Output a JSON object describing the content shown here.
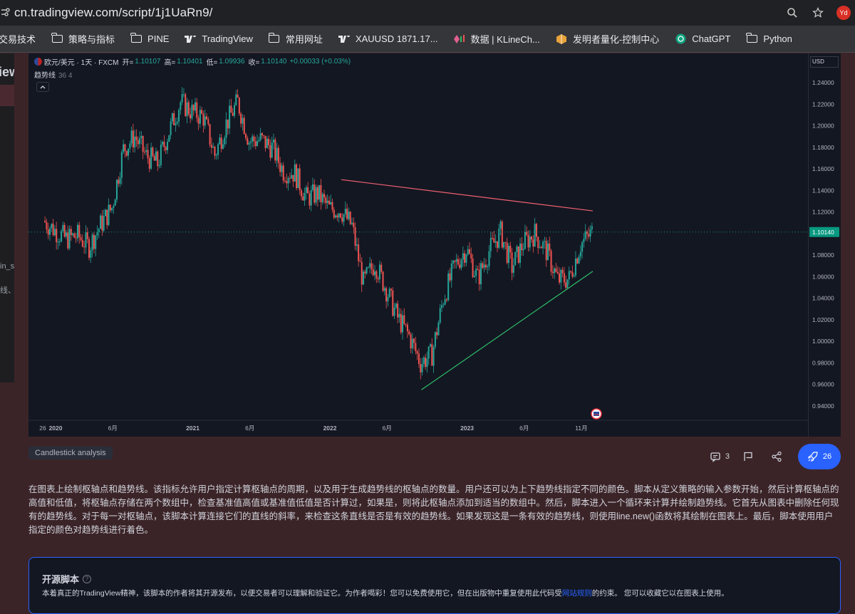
{
  "browser": {
    "url": "cn.tradingview.com/script/1j1UaRn9/",
    "avatar_text": "Yd",
    "bookmarks": [
      {
        "label": "交易技术",
        "icon": "folder-icon"
      },
      {
        "label": "策略与指标",
        "icon": "folder-icon"
      },
      {
        "label": "PINE",
        "icon": "folder-icon"
      },
      {
        "label": "TradingView",
        "icon": "tradingview-icon"
      },
      {
        "label": "常用网址",
        "icon": "folder-icon"
      },
      {
        "label": "XAUUSD 1871.17...",
        "icon": "tradingview-icon"
      },
      {
        "label": "数据 | KLineCh...",
        "icon": "klinechart-icon"
      },
      {
        "label": "发明者量化-控制中心",
        "icon": "fmz-icon"
      },
      {
        "label": "ChatGPT",
        "icon": "chatgpt-icon"
      },
      {
        "label": "Python",
        "icon": "folder-icon"
      }
    ]
  },
  "left_panel": {
    "title_fragment": "iew",
    "text_a": "in_s",
    "text_b": "线、"
  },
  "chart": {
    "symbol": "欧元/美元 · 1天 · FXCM",
    "open_label": "开=",
    "open": "1.10107",
    "high_label": "高=",
    "high": "1.10401",
    "low_label": "低=",
    "low": "1.09936",
    "close_label": "收=",
    "close": "1.10140",
    "change": "+0.00033 (+0.03%)",
    "indicator_name": "趋势线",
    "indicator_params": "36 4",
    "currency": "USD",
    "last_price_label": "1.10140",
    "colors": {
      "up": "#26a69a",
      "down": "#ef5350",
      "resistance": "#f06070",
      "support": "#2ebd6a",
      "price_tag": "#089981"
    }
  },
  "chart_data": {
    "type": "candlestick",
    "series_name": "欧元/美元 · 1天 · FXCM",
    "x_tick_labels": [
      "26",
      "2020",
      "6月",
      "2021",
      "6月",
      "2022",
      "6月",
      "2023",
      "6月",
      "11月"
    ],
    "y_tick_labels": [
      "1.24000",
      "1.22000",
      "1.20000",
      "1.18000",
      "1.16000",
      "1.14000",
      "1.12000",
      "1.10000",
      "1.08000",
      "1.06000",
      "1.04000",
      "1.02000",
      "1.00000",
      "0.98000",
      "0.96000",
      "0.94000"
    ],
    "ylim": [
      0.932,
      1.252
    ],
    "approx_closes_by_month": [
      {
        "t": "2019-12",
        "close": 1.112
      },
      {
        "t": "2020-01",
        "close": 1.103
      },
      {
        "t": "2020-02",
        "close": 1.095
      },
      {
        "t": "2020-03",
        "close": 1.098
      },
      {
        "t": "2020-04",
        "close": 1.088
      },
      {
        "t": "2020-05",
        "close": 1.108
      },
      {
        "t": "2020-06",
        "close": 1.124
      },
      {
        "t": "2020-07",
        "close": 1.178
      },
      {
        "t": "2020-08",
        "close": 1.19
      },
      {
        "t": "2020-09",
        "close": 1.172
      },
      {
        "t": "2020-10",
        "close": 1.165
      },
      {
        "t": "2020-11",
        "close": 1.195
      },
      {
        "t": "2020-12",
        "close": 1.222
      },
      {
        "t": "2021-01",
        "close": 1.213
      },
      {
        "t": "2021-02",
        "close": 1.208
      },
      {
        "t": "2021-03",
        "close": 1.173
      },
      {
        "t": "2021-04",
        "close": 1.202
      },
      {
        "t": "2021-05",
        "close": 1.222
      },
      {
        "t": "2021-06",
        "close": 1.186
      },
      {
        "t": "2021-07",
        "close": 1.187
      },
      {
        "t": "2021-08",
        "close": 1.18
      },
      {
        "t": "2021-09",
        "close": 1.158
      },
      {
        "t": "2021-10",
        "close": 1.156
      },
      {
        "t": "2021-11",
        "close": 1.133
      },
      {
        "t": "2021-12",
        "close": 1.137
      },
      {
        "t": "2022-01",
        "close": 1.123
      },
      {
        "t": "2022-02",
        "close": 1.122
      },
      {
        "t": "2022-03",
        "close": 1.107
      },
      {
        "t": "2022-04",
        "close": 1.054
      },
      {
        "t": "2022-05",
        "close": 1.073
      },
      {
        "t": "2022-06",
        "close": 1.048
      },
      {
        "t": "2022-07",
        "close": 1.022
      },
      {
        "t": "2022-08",
        "close": 1.005
      },
      {
        "t": "2022-09",
        "close": 0.98
      },
      {
        "t": "2022-10",
        "close": 0.988
      },
      {
        "t": "2022-11",
        "close": 1.04
      },
      {
        "t": "2022-12",
        "close": 1.07
      },
      {
        "t": "2023-01",
        "close": 1.086
      },
      {
        "t": "2023-02",
        "close": 1.058
      },
      {
        "t": "2023-03",
        "close": 1.084
      },
      {
        "t": "2023-04",
        "close": 1.101
      },
      {
        "t": "2023-05",
        "close": 1.069
      },
      {
        "t": "2023-06",
        "close": 1.091
      },
      {
        "t": "2023-07",
        "close": 1.1
      },
      {
        "t": "2023-08",
        "close": 1.084
      },
      {
        "t": "2023-09",
        "close": 1.057
      },
      {
        "t": "2023-10",
        "close": 1.058
      },
      {
        "t": "2023-11",
        "close": 1.09
      },
      {
        "t": "2023-12",
        "close": 1.101
      }
    ],
    "trendlines": [
      {
        "name": "resistance",
        "from": {
          "t": "2022-02",
          "y": 1.15
        },
        "to": {
          "t": "2023-12",
          "y": 1.121
        }
      },
      {
        "name": "support",
        "from": {
          "t": "2022-09",
          "y": 0.955
        },
        "to": {
          "t": "2023-12",
          "y": 1.065
        }
      }
    ]
  },
  "tag": "Candlestick analysis",
  "actions": {
    "comments": "3",
    "boosts": "26"
  },
  "description": "在图表上绘制枢轴点和趋势线。该指标允许用户指定计算枢轴点的周期，以及用于生成趋势线的枢轴点的数量。用户还可以为上下趋势线指定不同的颜色。脚本从定义策略的输入参数开始，然后计算枢轴点的高值和低值，将枢轴点存储在两个数组中，检查基准值高值或基准值低值是否计算过，如果是，则将此枢轴点添加到适当的数组中。然后，脚本进入一个循环来计算并绘制趋势线。它首先从图表中删除任何现有的趋势线。对于每一对枢轴点，该脚本计算连接它们的直线的斜率，来检查这条直线是否是有效的趋势线。如果发现这是一条有效的趋势线，则使用line.new()函数将其绘制在图表上。最后，脚本使用用户指定的颜色对趋势线进行着色。",
  "open_source": {
    "title": "开源脚本",
    "body_before_link": "本着真正的TradingView精神，该脚本的作者将其开源发布，以便交易者可以理解和验证它。为作者喝彩！您可以免费使用它，但在出版物中重复使用此代码受",
    "link": "网站规则",
    "body_after_link": "的约束。 您可以收藏它以在图表上使用。"
  }
}
